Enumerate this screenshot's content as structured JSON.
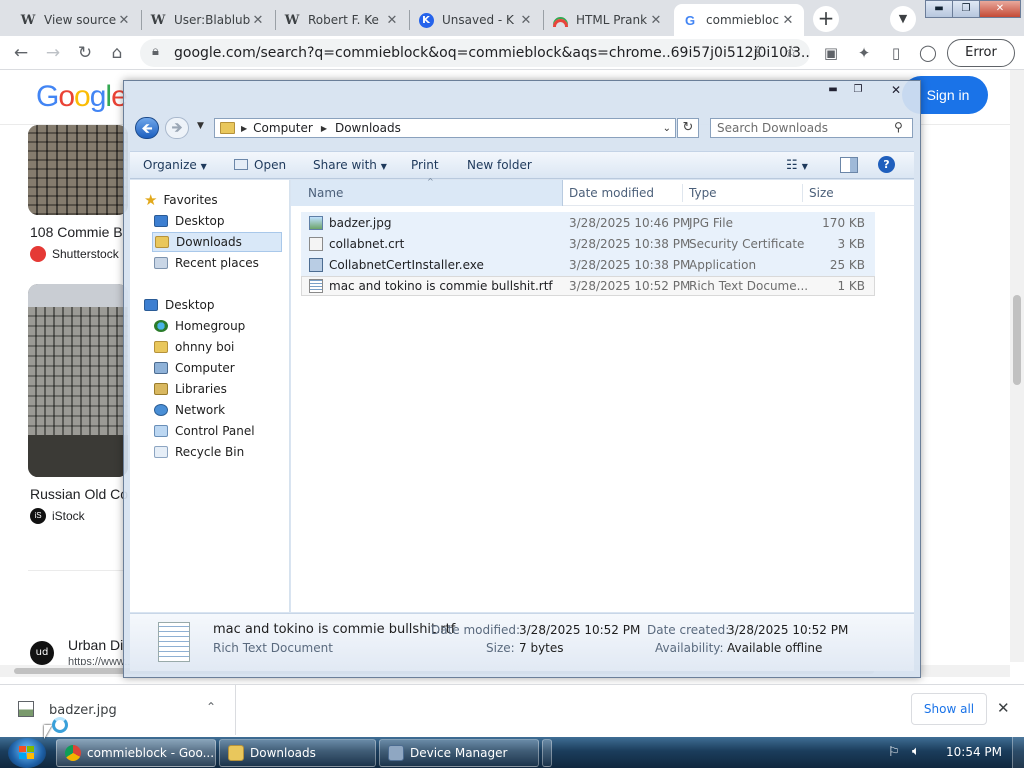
{
  "browser": {
    "tabs": [
      {
        "label": "View source",
        "favicon": "W"
      },
      {
        "label": "User:Blablub",
        "favicon": "W"
      },
      {
        "label": "Robert F. Ke",
        "favicon": "W"
      },
      {
        "label": "Unsaved - K",
        "favicon": "kahoot-icon"
      },
      {
        "label": "HTML Prank",
        "favicon": "rainbow-icon"
      },
      {
        "label": "commiebloc",
        "favicon": "G"
      }
    ],
    "url": "google.com/search?q=commieblock&oq=commieblock&aqs=chrome..69i57j0i512j0i10i3...",
    "profile_button": "Error",
    "window_controls": {
      "minimize": "▬",
      "restore": "❐",
      "close": "✕"
    }
  },
  "google": {
    "logo": "Google",
    "signin": "Sign in",
    "results": [
      {
        "caption": "108 Commie B",
        "source": "Shutterstock"
      },
      {
        "caption": "Russian Old Co",
        "source": "iStock"
      },
      {
        "caption": "Urban Di",
        "source": "https://www..."
      }
    ]
  },
  "explorer": {
    "breadcrumb": [
      "Computer",
      "Downloads"
    ],
    "search_placeholder": "Search Downloads",
    "commands": {
      "organize": "Organize",
      "open": "Open",
      "share": "Share with",
      "print": "Print",
      "new_folder": "New folder"
    },
    "nav": {
      "favorites_header": "Favorites",
      "favorites": [
        "Desktop",
        "Downloads",
        "Recent places"
      ],
      "desktop_header": "Desktop",
      "desktop_items": [
        "Homegroup",
        "ohnny boi",
        "Computer",
        "Libraries",
        "Network",
        "Control Panel",
        "Recycle Bin"
      ]
    },
    "columns": {
      "name": "Name",
      "date": "Date modified",
      "type": "Type",
      "size": "Size"
    },
    "files": [
      {
        "name": "badzer.jpg",
        "date": "3/28/2025 10:46 PM",
        "type": "JPG File",
        "size": "170 KB"
      },
      {
        "name": "collabnet.crt",
        "date": "3/28/2025 10:38 PM",
        "type": "Security Certificate",
        "size": "3 KB"
      },
      {
        "name": "CollabnetCertInstaller.exe",
        "date": "3/28/2025 10:38 PM",
        "type": "Application",
        "size": "25 KB"
      },
      {
        "name": "mac and tokino is commie bullshit.rtf",
        "date": "3/28/2025 10:52 PM",
        "type": "Rich Text Docume...",
        "size": "1 KB"
      }
    ],
    "details": {
      "filename": "mac and tokino is commie bullshit.rtf",
      "filetype": "Rich Text Document",
      "date_modified_label": "Date modified:",
      "date_modified": "3/28/2025 10:52 PM",
      "date_created_label": "Date created:",
      "date_created": "3/28/2025 10:52 PM",
      "size_label": "Size:",
      "size": "7 bytes",
      "availability_label": "Availability:",
      "availability": "Available offline"
    }
  },
  "download_bar": {
    "file": "badzer.jpg",
    "show_all": "Show all"
  },
  "taskbar": {
    "items": [
      {
        "label": "commieblock - Goo..."
      },
      {
        "label": "Downloads"
      },
      {
        "label": "Device Manager"
      }
    ],
    "clock": "10:54 PM"
  }
}
